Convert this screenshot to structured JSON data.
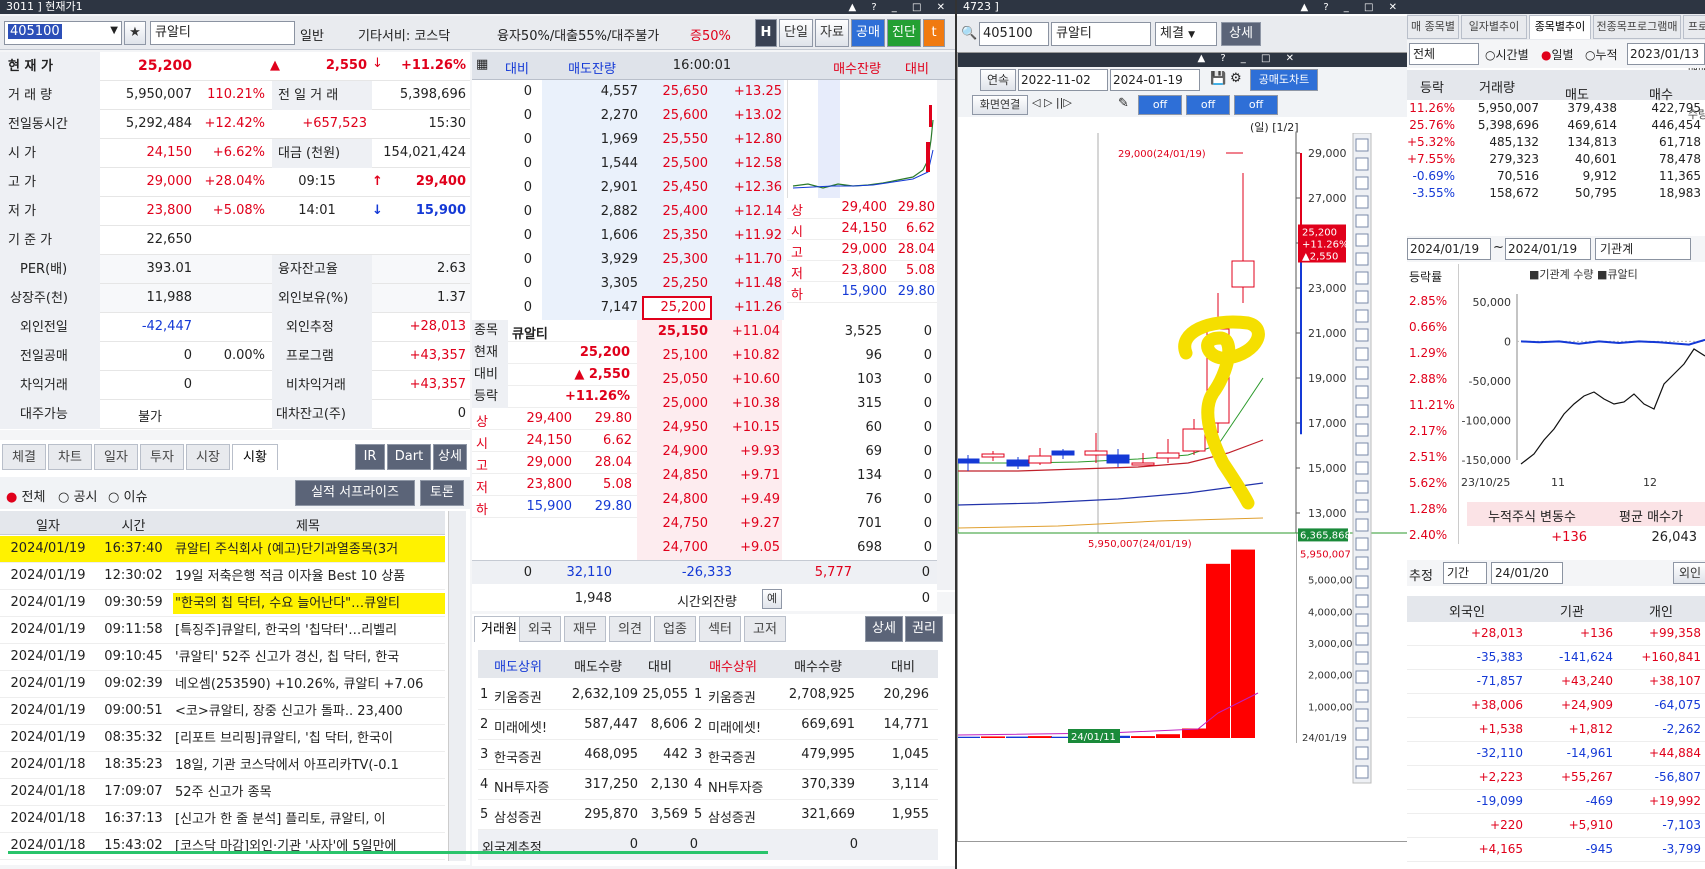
{
  "main": {
    "title": "3011 ] 현재가1",
    "code": "405100",
    "name": "큐알티",
    "market_type": "일반",
    "info": "기타서비: 코스닥",
    "margin_info": "융자50%/대출55%/대주불가",
    "margin_rate": "증50%",
    "btns": [
      "H",
      "단일",
      "자료",
      "공매",
      "진단",
      "t"
    ],
    "stats": [
      {
        "l": "현 재 가",
        "v1": "25,200",
        "v2": "▲",
        "v3": "2,550",
        "v4": "+11.26%"
      },
      {
        "l": "거 래 량",
        "v1": "5,950,007",
        "v2": "110.21%",
        "l2": "전 일 거 래",
        "v3": "5,398,696"
      },
      {
        "l": "전일동시간",
        "v1": "5,292,484",
        "v2": "+12.42%",
        "v3": "+657,523",
        "v4": "15:30"
      },
      {
        "l": "시   가",
        "v1": "24,150",
        "v2": "+6.62%",
        "l2": "대금 (천원)",
        "v3": "154,021,424"
      },
      {
        "l": "고   가",
        "v1": "29,000",
        "v2": "+28.04%",
        "l2": "09:15",
        "a": "↑",
        "v3": "29,400"
      },
      {
        "l": "저   가",
        "v1": "23,800",
        "v2": "+5.08%",
        "l2": "14:01",
        "a": "↓",
        "v3": "15,900"
      },
      {
        "l": "기 준 가",
        "v1": "22,650"
      },
      {
        "l": "PER(배)",
        "v1": "393.01",
        "l2": "융자잔고율",
        "v3": "2.63"
      },
      {
        "l": "상장주(천)",
        "v1": "11,988",
        "l2": "외인보유(%)",
        "v3": "1.37"
      },
      {
        "l": "외인전일",
        "v1": "-42,447",
        "l2": "외인추정",
        "v3": "+28,013"
      },
      {
        "l": "전일공매",
        "v1": "0",
        "v2": "0.00%",
        "l2": "프로그램",
        "v3": "+43,357"
      },
      {
        "l": "차익거래",
        "v1": "0",
        "l2": "비차익거래",
        "v3": "+43,357"
      },
      {
        "l": "대주가능",
        "v1": "불가",
        "l2": "대차잔고(주)",
        "v3": "0"
      }
    ],
    "tabs": [
      "체결",
      "차트",
      "일자",
      "투자",
      "시장",
      "시황"
    ],
    "tab_btns": [
      "IR",
      "Dart",
      "상세"
    ],
    "news_filter": [
      "전체",
      "공시",
      "이슈"
    ],
    "news_btn": "실적 서프라이즈",
    "news_btn2": "토론",
    "news_headers": [
      "일자",
      "시간",
      "제목"
    ],
    "news": [
      {
        "d": "2024/01/19",
        "t": "16:37:40",
        "s": "큐알티 주식회사 (예고)단기과열종목(3거",
        "hl": true
      },
      {
        "d": "2024/01/19",
        "t": "12:30:02",
        "s": "19일 저축은행 적금 이자율 Best 10 상품"
      },
      {
        "d": "2024/01/19",
        "t": "09:30:59",
        "s": "\"한국의 칩 닥터, 수요 늘어난다\"…큐알티",
        "hl": true
      },
      {
        "d": "2024/01/19",
        "t": "09:11:58",
        "s": "[특징주]큐알티, 한국의 '칩닥터'…리벨리"
      },
      {
        "d": "2024/01/19",
        "t": "09:10:45",
        "s": "'큐알티' 52주 신고가 경신, 칩 닥터, 한국"
      },
      {
        "d": "2024/01/19",
        "t": "09:02:39",
        "s": "네오셈(253590) +10.26%, 큐알티 +7.06"
      },
      {
        "d": "2024/01/19",
        "t": "09:00:51",
        "s": "<코>큐알티, 장중 신고가 돌파.. 23,400"
      },
      {
        "d": "2024/01/19",
        "t": "08:35:32",
        "s": "[리포트 브리핑]큐알티, '칩 닥터, 한국이"
      },
      {
        "d": "2024/01/18",
        "t": "18:35:23",
        "s": "18일, 기관 코스닥에서 아프리카TV(-0.1"
      },
      {
        "d": "2024/01/18",
        "t": "17:09:07",
        "s": "52주 신고가 종목"
      },
      {
        "d": "2024/01/18",
        "t": "16:37:13",
        "s": "[신고가 한 줄 분석] 플리토, 큐알티, 이"
      },
      {
        "d": "2024/01/18",
        "t": "15:43:02",
        "s": "[코스닥 마감]외인·기관 '사자'에 5일만에"
      }
    ]
  },
  "ob": {
    "header": [
      "대비",
      "매도잔량",
      "16:00:01",
      "매수잔량",
      "대비"
    ],
    "asks": [
      {
        "d": "0",
        "q": "4,557",
        "p": "25,650",
        "r": "+13.25"
      },
      {
        "d": "0",
        "q": "2,270",
        "p": "25,600",
        "r": "+13.02"
      },
      {
        "d": "0",
        "q": "1,969",
        "p": "25,550",
        "r": "+12.80"
      },
      {
        "d": "0",
        "q": "1,544",
        "p": "25,500",
        "r": "+12.58"
      },
      {
        "d": "0",
        "q": "2,901",
        "p": "25,450",
        "r": "+12.36"
      },
      {
        "d": "0",
        "q": "2,882",
        "p": "25,400",
        "r": "+12.14"
      },
      {
        "d": "0",
        "q": "1,606",
        "p": "25,350",
        "r": "+11.92"
      },
      {
        "d": "0",
        "q": "3,929",
        "p": "25,300",
        "r": "+11.70"
      },
      {
        "d": "0",
        "q": "3,305",
        "p": "25,250",
        "r": "+11.48"
      },
      {
        "d": "0",
        "q": "7,147",
        "p": "25,200",
        "r": "+11.26"
      }
    ],
    "bids": [
      {
        "p": "25,150",
        "r": "+11.04",
        "q": "3,525",
        "d": "0"
      },
      {
        "p": "25,100",
        "r": "+10.82",
        "q": "96",
        "d": "0"
      },
      {
        "p": "25,050",
        "r": "+10.60",
        "q": "103",
        "d": "0"
      },
      {
        "p": "25,000",
        "r": "+10.38",
        "q": "315",
        "d": "0"
      },
      {
        "p": "24,950",
        "r": "+10.15",
        "q": "60",
        "d": "0"
      },
      {
        "p": "24,900",
        "r": "+9.93",
        "q": "69",
        "d": "0"
      },
      {
        "p": "24,850",
        "r": "+9.71",
        "q": "134",
        "d": "0"
      },
      {
        "p": "24,800",
        "r": "+9.49",
        "q": "76",
        "d": "0"
      },
      {
        "p": "24,750",
        "r": "+9.27",
        "q": "701",
        "d": "0"
      },
      {
        "p": "24,700",
        "r": "+9.05",
        "q": "698",
        "d": "0"
      }
    ],
    "side_right": [
      {
        "l": "상",
        "a": "29,400",
        "b": "29.80"
      },
      {
        "l": "시",
        "a": "24,150",
        "b": "6.62"
      },
      {
        "l": "고",
        "a": "29,000",
        "b": "28.04"
      },
      {
        "l": "저",
        "a": "23,800",
        "b": "5.08"
      },
      {
        "l": "하",
        "a": "15,900",
        "b": "29.80"
      }
    ],
    "side_left": [
      {
        "l": "종목",
        "v": "큐알티"
      },
      {
        "l": "현재",
        "v": "25,200"
      },
      {
        "l": "대비",
        "v": "▲ 2,550"
      },
      {
        "l": "등락",
        "v": "+11.26%"
      }
    ],
    "side_left2": [
      {
        "l": "상",
        "a": "29,400",
        "b": "29.80"
      },
      {
        "l": "시",
        "a": "24,150",
        "b": "6.62"
      },
      {
        "l": "고",
        "a": "29,000",
        "b": "28.04"
      },
      {
        "l": "저",
        "a": "23,800",
        "b": "5.08"
      },
      {
        "l": "하",
        "a": "15,900",
        "b": "29.80"
      }
    ],
    "totals": {
      "d": "0",
      "ask": "32,110",
      "diff": "-26,333",
      "bid": "5,777",
      "d2": "0"
    },
    "after": {
      "q": "1,948",
      "label": "시간외잔량",
      "btn": "예",
      "v": "0"
    },
    "tabs": [
      "거래원",
      "외국",
      "재무",
      "의견",
      "업종",
      "섹터",
      "고저"
    ],
    "tab_btns": [
      "상세",
      "권리"
    ],
    "brk_header": [
      "매도상위",
      "매도수량",
      "대비",
      "매수상위",
      "매수수량",
      "대비"
    ],
    "brokers": [
      {
        "n": "1",
        "s": "키움증권",
        "sq": "2,632,109",
        "sd": "25,055",
        "b": "키움증권",
        "bq": "2,708,925",
        "bd": "20,296"
      },
      {
        "n": "2",
        "s": "미래에셋!",
        "sq": "587,447",
        "sd": "8,606",
        "b": "미래에셋!",
        "bq": "669,691",
        "bd": "14,771"
      },
      {
        "n": "3",
        "s": "한국증권",
        "sq": "468,095",
        "sd": "442",
        "b": "한국증권",
        "bq": "479,995",
        "bd": "1,045"
      },
      {
        "n": "4",
        "s": "NH투자증",
        "sq": "317,250",
        "sd": "2,130",
        "b": "NH투자증",
        "bq": "370,339",
        "bd": "3,114"
      },
      {
        "n": "5",
        "s": "삼성증권",
        "sq": "295,870",
        "sd": "3,569",
        "b": "삼성증권",
        "bq": "321,669",
        "bd": "1,955"
      }
    ],
    "foreign": {
      "l": "외국계추정",
      "a": "0",
      "b": "0",
      "c": "0"
    }
  },
  "chart": {
    "title": "4723 ]",
    "code": "405100",
    "name": "큐알티",
    "type_sel": "체결",
    "detail_btn": "상세",
    "cont_btn": "연속",
    "date_from": "2022-11-02",
    "date_to": "2024-01-19",
    "short_btn": "공매도차트",
    "screen_link": "화면연결",
    "off_btns": [
      "off",
      "off",
      "off"
    ],
    "period_label": "(일) [1/2]",
    "y_ticks": [
      "29,000",
      "27,000",
      "25,000",
      "23,000",
      "21,000",
      "19,000",
      "17,000",
      "15,000",
      "13,000"
    ],
    "high_label": "29,000(24/01/19)",
    "cur_box": [
      "25,200",
      "+11.26%",
      "▲2,550"
    ],
    "vol_ticks": [
      "5,000,000",
      "4,000,000",
      "3,000,000",
      "2,000,000",
      "1,000,000"
    ],
    "vol_high_label": "5,950,007(24/01/19)",
    "vol_cur": "6,365,868",
    "vol_cur2": "5,950,007",
    "date_left": "24/01/11",
    "date_right": "24/01/19"
  },
  "prog": {
    "tabs": [
      "매 종목별추이",
      "일자별추이",
      "종목별추이",
      "전종목프로그램매매",
      "프로그램매매공시수량"
    ],
    "sel1": "전체",
    "radio": [
      "시간별",
      "일별",
      "누적"
    ],
    "date": "2023/01/13",
    "headers": [
      "등락",
      "거래량",
      "매도",
      "매수"
    ],
    "rows": [
      {
        "a": "11.26%",
        "b": "5,950,007",
        "c": "379,438",
        "d": "422,795"
      },
      {
        "a": "25.76%",
        "b": "5,398,696",
        "c": "469,614",
        "d": "446,454"
      },
      {
        "a": "+5.32%",
        "b": "485,132",
        "c": "134,813",
        "d": "61,718"
      },
      {
        "a": "+7.55%",
        "b": "279,323",
        "c": "40,601",
        "d": "78,478"
      },
      {
        "a": "-0.69%",
        "b": "70,516",
        "c": "9,912",
        "d": "11,365"
      },
      {
        "a": "-3.55%",
        "b": "158,672",
        "c": "50,795",
        "d": "18,983"
      }
    ]
  },
  "inv": {
    "date_from": "2024/01/19",
    "date_to": "2024/01/19",
    "sel": "기관계",
    "legend": [
      "기관계 수량",
      "큐알티"
    ],
    "pct_col": [
      "등락률",
      "2.85%",
      "0.66%",
      "1.29%",
      "2.88%",
      "11.21%",
      "2.17%",
      "2.51%",
      "5.62%",
      "1.28%",
      "2.40%"
    ],
    "y_ticks": [
      "50,000",
      "0",
      "-50,000",
      "-100,000",
      "-150,000"
    ],
    "x_ticks": [
      "23/10/25",
      "11",
      "12"
    ],
    "box_h": [
      "누적주식 변동수",
      "평균 매수가"
    ],
    "box_v": [
      "+136",
      "26,043"
    ],
    "est_label": "추정",
    "period_sel": "기간",
    "period_date": "24/01/20",
    "btn": "외인",
    "headers": [
      "외국인",
      "기관",
      "개인"
    ],
    "rows": [
      {
        "a": "+28,013",
        "b": "+136",
        "c": "+99,358"
      },
      {
        "a": "-35,383",
        "b": "-141,624",
        "c": "+160,841"
      },
      {
        "a": "-71,857",
        "b": "+43,240",
        "c": "+38,107"
      },
      {
        "a": "+38,006",
        "b": "+24,909",
        "c": "-64,075"
      },
      {
        "a": "+1,538",
        "b": "+1,812",
        "c": "-2,262"
      },
      {
        "a": "-32,110",
        "b": "-14,961",
        "c": "+44,884"
      },
      {
        "a": "+2,223",
        "b": "+55,267",
        "c": "-56,807"
      },
      {
        "a": "-19,099",
        "b": "-469",
        "c": "+19,992"
      },
      {
        "a": "+220",
        "b": "+5,910",
        "c": "-7,103"
      },
      {
        "a": "+4,165",
        "b": "-945",
        "c": "-3,799"
      }
    ]
  },
  "colors": {
    "up": "#e0001b",
    "down": "#1439d6",
    "highlight": "#fff200",
    "navy": "#2d3542"
  }
}
